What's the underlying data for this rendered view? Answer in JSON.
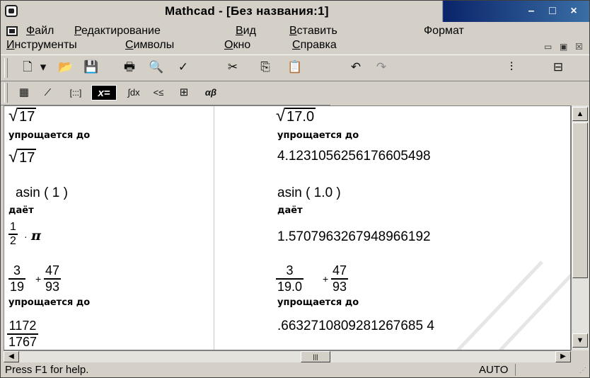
{
  "window": {
    "title": "Mathcad - [Без названия:1]",
    "controls": {
      "minimize": "–",
      "maximize": "□",
      "close": "×"
    }
  },
  "menubar": {
    "row1": [
      {
        "accel": "Ф",
        "rest": "айл"
      },
      {
        "accel": "Р",
        "rest": "едактирование"
      },
      {
        "accel": "В",
        "rest": "ид"
      },
      {
        "accel": "В",
        "rest": "ставить"
      },
      {
        "accel": "",
        "rest": "Формат"
      }
    ],
    "row2": [
      {
        "accel": "И",
        "rest": "нструменты"
      },
      {
        "accel": "С",
        "rest": "имволы"
      },
      {
        "accel": "О",
        "rest": "кно"
      },
      {
        "accel": "С",
        "rest": "правка"
      }
    ],
    "mdi_controls": {
      "minimize": "▭",
      "restore": "▣",
      "close": "☒"
    }
  },
  "toolbar": {
    "icons": [
      "new-document-icon",
      "dropdown-arrow-icon",
      "open-folder-icon",
      "save-icon",
      "print-icon",
      "print-preview-icon",
      "spell-check-icon",
      "cut-icon",
      "copy-icon",
      "paste-icon",
      "undo-icon",
      "redo-icon",
      "align-horizontal-icon",
      "align-vertical-icon"
    ],
    "glyphs": [
      "🗋",
      "▾",
      "📂",
      "💾",
      "🖶",
      "🔍",
      "✓",
      "✂",
      "⎘",
      "📋",
      "↶",
      "↷",
      "⫶",
      "⊟"
    ]
  },
  "mathbar": {
    "icons": [
      "calculator-icon",
      "graph-icon",
      "matrix-icon",
      "evaluation-icon",
      "calculus-icon",
      "boolean-icon",
      "programming-icon",
      "greek-icon"
    ],
    "glyphs": [
      "▦",
      "⁄",
      "[:::]",
      "x=",
      "∫dx",
      "<≤",
      "⊞",
      "αβ"
    ],
    "pressed": "x="
  },
  "worksheet": {
    "left": {
      "expr1": "17",
      "label1": "упрощается до",
      "result1": "17",
      "expr2": "asin ( 1 )",
      "label2": "даёт",
      "result2_num": "1",
      "result2_den": "2",
      "result2_pi": "π",
      "expr3_num1": "3",
      "expr3_den1": "19",
      "expr3_num2": "47",
      "expr3_den2": "93",
      "label3": "упрощается до",
      "result3_num": "1172",
      "result3_den": "1767"
    },
    "right": {
      "expr1": "17.0",
      "label1": "упрощается до",
      "result1": "4.1231056256176605498",
      "expr2": "asin ( 1.0 )",
      "label2": "даёт",
      "result2": "1.5707963267948966192",
      "expr3_num1": "3",
      "expr3_den1": "19.0",
      "expr3_num2": "47",
      "expr3_den2": "93",
      "label3": "упрощается до",
      "result3": ".6632710809281267685 4"
    },
    "operators": {
      "plus": "+",
      "dot": "·"
    }
  },
  "statusbar": {
    "help": "Press F1 for help.",
    "mode": "AUTO"
  },
  "colors": {
    "chrome": "#d4d0c8",
    "title_active": "#0a246a",
    "worksheet_bg": "#ffffff"
  }
}
